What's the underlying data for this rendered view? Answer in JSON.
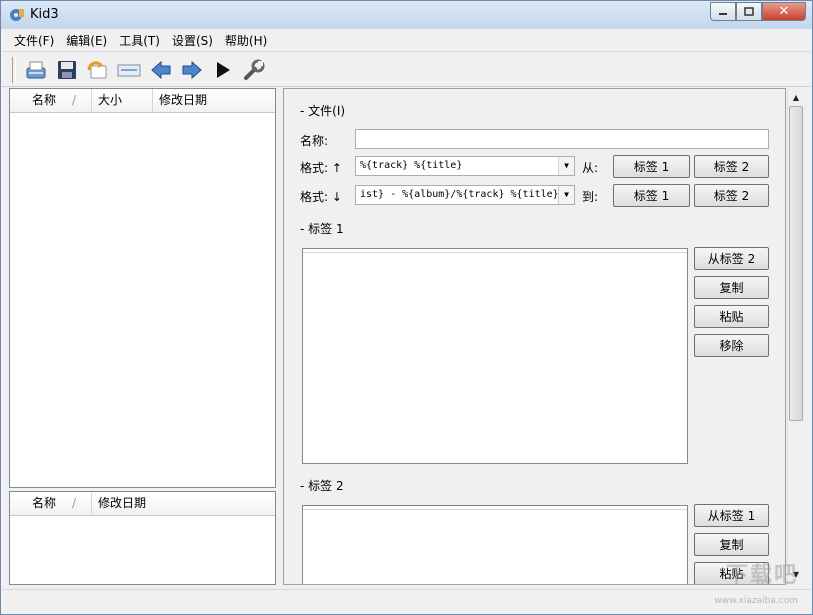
{
  "window": {
    "title": "Kid3"
  },
  "menu": [
    "文件(F)",
    "编辑(E)",
    "工具(T)",
    "设置(S)",
    "帮助(H)"
  ],
  "toolbar": {
    "icons": [
      "open-icon",
      "save-icon",
      "revert-icon",
      "properties-icon",
      "previous-icon",
      "next-icon",
      "play-icon",
      "settings-icon"
    ]
  },
  "file_list": {
    "columns": [
      "名称",
      "大小",
      "修改日期"
    ]
  },
  "dir_list": {
    "columns": [
      "名称",
      "修改日期"
    ]
  },
  "file_section": {
    "title": "- 文件(I)",
    "name_label": "名称:",
    "name_value": "",
    "format_from_label": "格式: ↑",
    "format_from_value": "%{track} %{title}",
    "from_label": "从:",
    "format_to_label": "格式: ↓",
    "format_to_value": "ist} - %{album}/%{track} %{title}",
    "to_label": "到:",
    "tag1_btn": "标签 1",
    "tag2_btn": "标签 2"
  },
  "tag1_section": {
    "title": "- 标签 1",
    "from_btn": "从标签 2",
    "copy_btn": "复制",
    "paste_btn": "粘贴",
    "remove_btn": "移除"
  },
  "tag2_section": {
    "title": "- 标签 2",
    "from_btn": "从标签 1",
    "copy_btn": "复制",
    "paste_btn": "粘贴"
  },
  "watermark": {
    "text": "下载吧",
    "url": "www.xiazaiba.com"
  }
}
